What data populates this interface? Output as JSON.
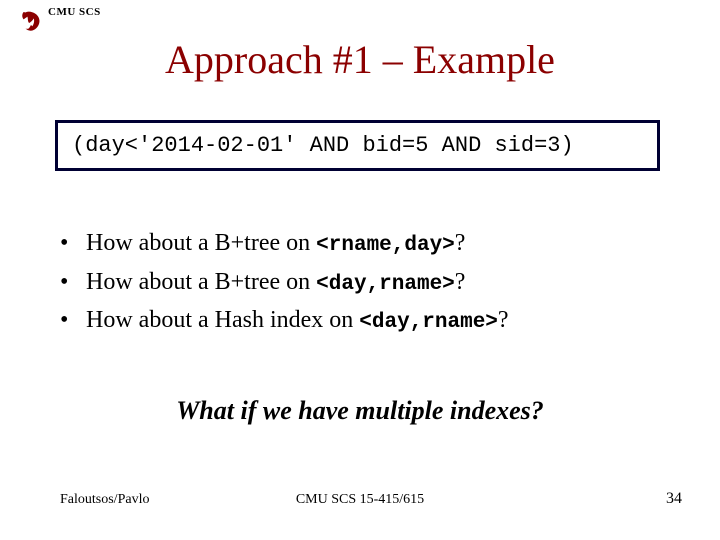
{
  "header": {
    "org": "CMU SCS"
  },
  "title": "Approach #1 – Example",
  "query": "(day<'2014-02-01' AND bid=5 AND sid=3)",
  "bullets": [
    {
      "prefix": "How about a B+tree on ",
      "code": "<rname,day>",
      "suffix": "?"
    },
    {
      "prefix": "How about a B+tree on ",
      "code": "<day,rname>",
      "suffix": "?"
    },
    {
      "prefix": "How about a Hash index on ",
      "code": "<day,rname>",
      "suffix": "?"
    }
  ],
  "question": "What if we have multiple indexes?",
  "footer": {
    "left": "Faloutsos/Pavlo",
    "center": "CMU SCS 15-415/615",
    "right": "34"
  }
}
